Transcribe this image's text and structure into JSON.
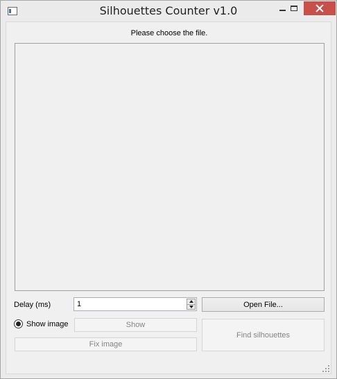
{
  "window": {
    "title": "Silhouettes Counter v1.0"
  },
  "status": {
    "message": "Please choose the file."
  },
  "controls": {
    "delay_label": "Delay (ms)",
    "delay_value": "1",
    "open_file_label": "Open File...",
    "show_image_label": "Show image",
    "show_image_checked": true,
    "show_label": "Show",
    "fix_image_label": "Fix image",
    "find_silhouettes_label": "Find silhouettes"
  },
  "colors": {
    "close_button": "#c7504b",
    "window_background": "#f0f0f0"
  },
  "icons": {
    "app": "app-window-icon",
    "minimize": "minimize-icon",
    "maximize": "maximize-icon",
    "close": "close-icon",
    "spin_up": "arrow-up-icon",
    "spin_down": "arrow-down-icon",
    "grip": "resize-grip-icon"
  }
}
